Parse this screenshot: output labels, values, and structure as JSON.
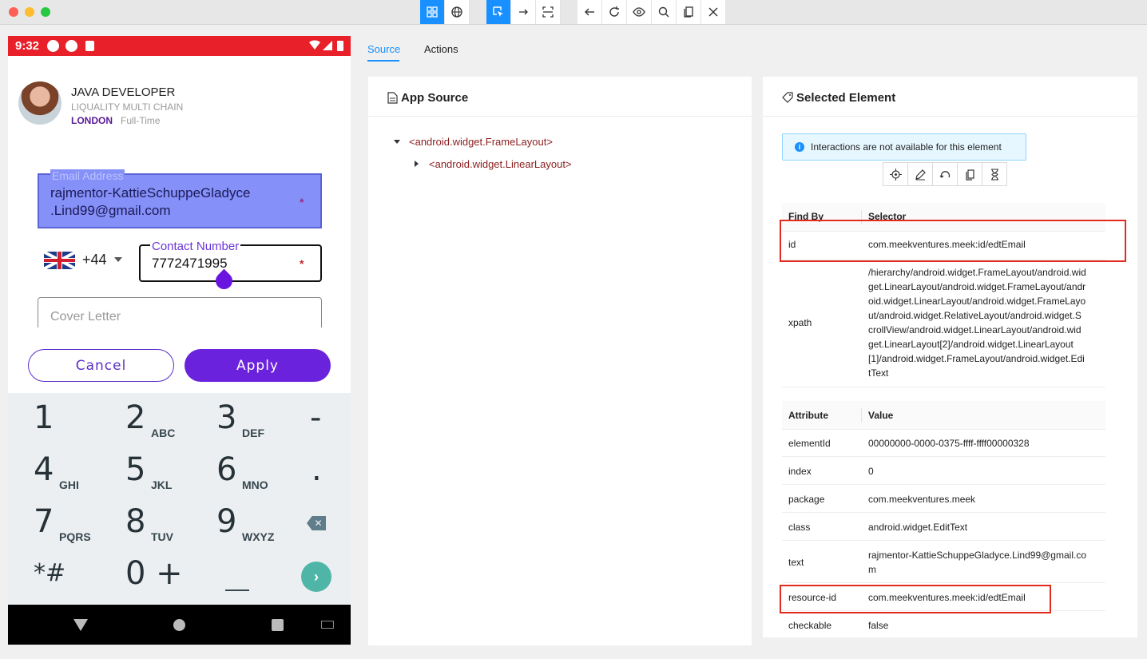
{
  "toolbar": {
    "buttons": [
      "native-app-mode",
      "web-mode",
      "select-elements",
      "swipe-by-coordinates",
      "tap-by-coordinates",
      "back",
      "refresh-source",
      "toggle-show-attributes",
      "search-for-element",
      "copy-xml-source",
      "quit-session"
    ]
  },
  "device": {
    "status_bar": {
      "time": "9:32"
    },
    "job": {
      "title": "JAVA DEVELOPER",
      "company": "LIQUALITY MULTI CHAIN",
      "city": "LONDON",
      "type": "Full-Time"
    },
    "form": {
      "email_label": "Email Address",
      "email_value_line1": "rajmentor-KattieSchuppeGladyce",
      "email_value_line2": ".Lind99@gmail.com",
      "required_mark": "*",
      "country_code": "+44",
      "phone_label": "Contact Number",
      "phone_value": "7772471995",
      "cover_placeholder": "Cover Letter",
      "cancel_label": "Cancel",
      "apply_label": "Apply"
    },
    "keypad": {
      "keys": [
        {
          "num": "1",
          "letters": ""
        },
        {
          "num": "2",
          "letters": "ABC"
        },
        {
          "num": "3",
          "letters": "DEF"
        },
        {
          "num": "-",
          "letters": ""
        },
        {
          "num": "4",
          "letters": "GHI"
        },
        {
          "num": "5",
          "letters": "JKL"
        },
        {
          "num": "6",
          "letters": "MNO"
        },
        {
          "num": ".",
          "letters": ""
        },
        {
          "num": "7",
          "letters": "PQRS"
        },
        {
          "num": "8",
          "letters": "TUV"
        },
        {
          "num": "9",
          "letters": "WXYZ"
        },
        {
          "num": "*#",
          "letters": ""
        },
        {
          "num": "0 +",
          "letters": ""
        }
      ],
      "go_label": "›"
    }
  },
  "tabs": [
    "Source",
    "Actions"
  ],
  "source": {
    "title": "App Source",
    "tree": [
      "<android.widget.FrameLayout>",
      "<android.widget.LinearLayout>"
    ]
  },
  "selected": {
    "title": "Selected Element",
    "info": "Interactions are not available for this element",
    "find_by_header": "Find By",
    "selector_header": "Selector",
    "find_by": [
      {
        "key": "id",
        "value": "com.meekventures.meek:id/edtEmail"
      },
      {
        "key": "xpath",
        "lines": [
          "/hierarchy/android.widget.FrameLayout/android.wid",
          "get.LinearLayout/android.widget.FrameLayout/andr",
          "oid.widget.LinearLayout/android.widget.FrameLayo",
          "ut/android.widget.RelativeLayout/android.widget.S",
          "crollView/android.widget.LinearLayout/android.wid",
          "get.LinearLayout[2]/android.widget.LinearLayout",
          "[1]/android.widget.FrameLayout/android.widget.Edi",
          "tText"
        ]
      }
    ],
    "attr_header": "Attribute",
    "value_header": "Value",
    "attributes": [
      {
        "key": "elementId",
        "value": "00000000-0000-0375-ffff-ffff00000328"
      },
      {
        "key": "index",
        "value": "0"
      },
      {
        "key": "package",
        "value": "com.meekventures.meek"
      },
      {
        "key": "class",
        "value": "android.widget.EditText"
      },
      {
        "key": "text",
        "value": "rajmentor-KattieSchuppeGladyce.Lind99@gmail.co",
        "value2": "m"
      },
      {
        "key": "resource-id",
        "value": "com.meekventures.meek:id/edtEmail"
      },
      {
        "key": "checkable",
        "value": "false"
      }
    ]
  },
  "colors": {
    "accent": "#1890ff",
    "highlight": "#e02b1e",
    "status_bar": "#e8202a",
    "apply": "#6a22dc"
  }
}
